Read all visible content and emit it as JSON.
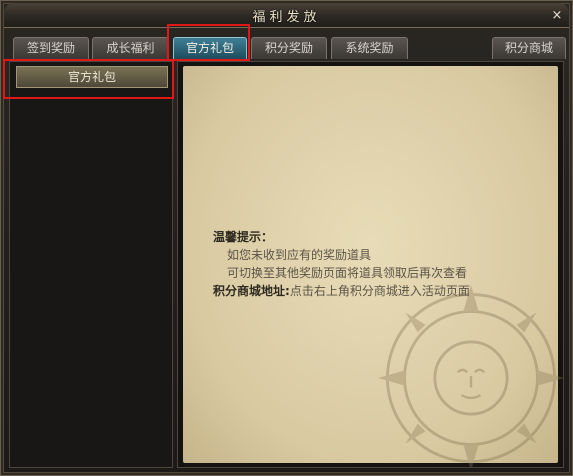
{
  "window": {
    "title": "福利发放",
    "close_label": "×"
  },
  "tabs": [
    {
      "label": "签到奖励",
      "active": false
    },
    {
      "label": "成长福利",
      "active": false
    },
    {
      "label": "官方礼包",
      "active": true
    },
    {
      "label": "积分奖励",
      "active": false
    },
    {
      "label": "系统奖励",
      "active": false
    },
    {
      "label": "积分商城",
      "active": false
    }
  ],
  "sidebar": {
    "items": [
      {
        "label": "官方礼包"
      }
    ]
  },
  "notice": {
    "heading": "温馨提示：",
    "line1": "如您未收到应有的奖励道具",
    "line2": "可切换至其他奖励页面将道具领取后再次查看",
    "addr_label": "积分商城地址:",
    "addr_text": "点击右上角积分商城进入活动页面"
  },
  "colors": {
    "highlight": "#e01818",
    "active_tab": "#2f6a80",
    "parchment": "#dccfa8"
  },
  "icons": {
    "close": "close-icon",
    "emblem": "sun-emblem-icon"
  }
}
